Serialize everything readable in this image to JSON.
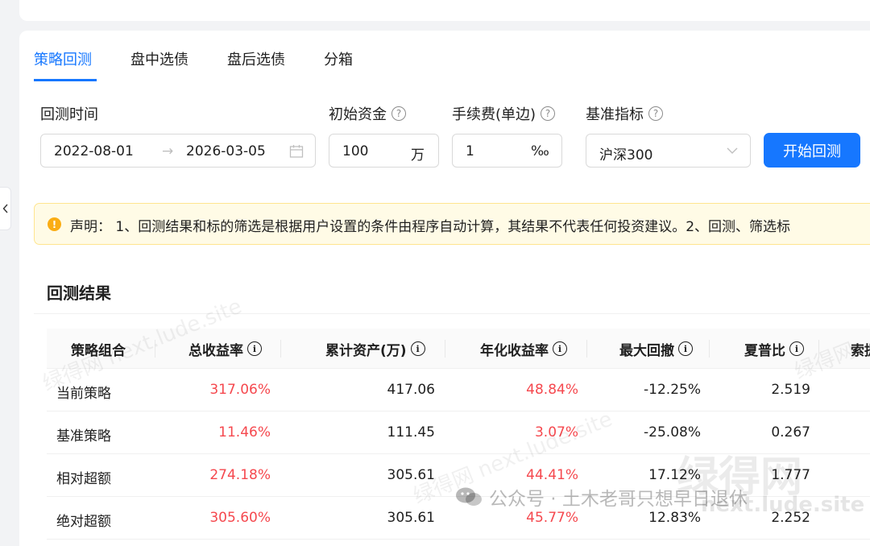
{
  "tabs": [
    {
      "label": "策略回测",
      "active": true
    },
    {
      "label": "盘中选债",
      "active": false
    },
    {
      "label": "盘后选债",
      "active": false
    },
    {
      "label": "分箱",
      "active": false
    }
  ],
  "form": {
    "period_label": "回测时间",
    "start_date": "2022-08-01",
    "arrow": "→",
    "end_date": "2026-03-05",
    "capital_label": "初始资金",
    "capital_value": "100",
    "capital_unit": "万",
    "fee_label": "手续费(单边)",
    "fee_value": "1",
    "fee_unit": "‰",
    "benchmark_label": "基准指标",
    "benchmark_value": "沪深300",
    "help_glyph": "?",
    "start_button": "开始回测"
  },
  "notice": {
    "text": "声明： 1、回测结果和标的筛选是根据用户设置的条件由程序自动计算，其结果不代表任何投资建议。2、回测、筛选标"
  },
  "results": {
    "title": "回测结果",
    "info_glyph": "i",
    "columns": [
      "策略组合",
      "总收益率",
      "累计资产(万)",
      "年化收益率",
      "最大回撤",
      "夏普比",
      "索提"
    ],
    "rows": [
      {
        "name": "当前策略",
        "total": "317.06%",
        "assets": "417.06",
        "annual": "48.84%",
        "drawdown": "-12.25%",
        "sharpe": "2.519"
      },
      {
        "name": "基准策略",
        "total": "11.46%",
        "assets": "111.45",
        "annual": "3.07%",
        "drawdown": "-25.08%",
        "sharpe": "0.267"
      },
      {
        "name": "相对超额",
        "total": "274.18%",
        "assets": "305.61",
        "annual": "44.41%",
        "drawdown": "17.12%",
        "sharpe": "1.777"
      },
      {
        "name": "绝对超额",
        "total": "305.60%",
        "assets": "305.61",
        "annual": "45.77%",
        "drawdown": "12.83%",
        "sharpe": "2.252"
      }
    ]
  },
  "watermark": {
    "site": "绿得网 next.lude.site",
    "logo": "绿得网",
    "logo_site": "next.lude.site",
    "public_account": "公众号 · 土木老哥只想早日退休"
  },
  "colors": {
    "accent": "#1677ff",
    "positive": "#f5484e",
    "warning": "#faad14"
  }
}
